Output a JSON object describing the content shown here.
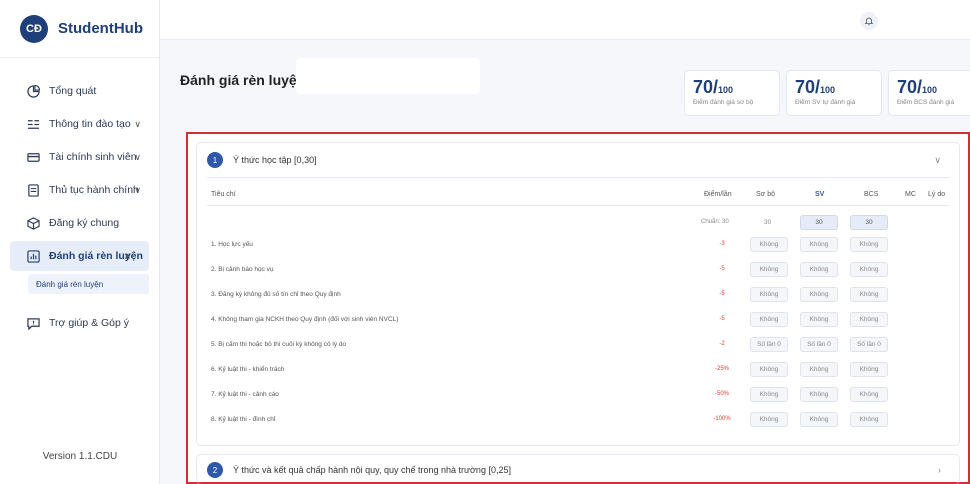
{
  "app": {
    "name": "StudentHub",
    "logo_text": "CĐ",
    "version": "Version 1.1.CDU"
  },
  "sidebar": {
    "items": [
      {
        "label": "Tổng quát",
        "icon": "pie-chart-icon",
        "has_chevron": false
      },
      {
        "label": "Thông tin đào tạo",
        "icon": "list-icon",
        "has_chevron": true
      },
      {
        "label": "Tài chính sinh viên",
        "icon": "card-icon",
        "has_chevron": true
      },
      {
        "label": "Thủ tục hành chính",
        "icon": "document-icon",
        "has_chevron": true
      },
      {
        "label": "Đăng ký chung",
        "icon": "box-icon",
        "has_chevron": false
      },
      {
        "label": "Đánh giá rèn luyện",
        "icon": "bar-chart-icon",
        "has_chevron": true,
        "active": true
      },
      {
        "label": "Trợ giúp & Góp ý",
        "icon": "message-icon",
        "has_chevron": false
      }
    ],
    "sub_item": "Đánh giá rèn luyện"
  },
  "header": {
    "notification_icon": "bell-icon"
  },
  "page": {
    "title": "Đánh giá rèn luyện",
    "scores": [
      {
        "value": "70/",
        "denominator": "100",
        "label": "Điểm đánh giá sơ bộ"
      },
      {
        "value": "70/",
        "denominator": "100",
        "label": "Điểm SV tự đánh giá"
      },
      {
        "value": "70/",
        "denominator": "100",
        "label": "Điểm BCS đánh giá"
      }
    ]
  },
  "sections": [
    {
      "number": "1",
      "title": "Ý thức học tập [0,30]",
      "expanded": true
    },
    {
      "number": "2",
      "title": "Ý thức và kết quả chấp hành nội quy, quy chế trong nhà trường [0,25]",
      "expanded": false
    }
  ],
  "table": {
    "headers": {
      "criteria": "Tiêu chí",
      "points": "Điểm/lần",
      "preliminary": "Sơ bộ",
      "sv": "SV",
      "bcs": "BCS",
      "mc": "MC",
      "reason": "Lý do"
    },
    "standard_row": {
      "label": "Chuẩn: 30",
      "preliminary": "30",
      "sv": "30",
      "bcs": "30"
    },
    "rows": [
      {
        "criteria": "1. Học lực yếu",
        "points": "-3",
        "preliminary": "Không",
        "sv": "Không",
        "bcs": "Không"
      },
      {
        "criteria": "2. Bị cảnh báo học vụ",
        "points": "-5",
        "preliminary": "Không",
        "sv": "Không",
        "bcs": "Không"
      },
      {
        "criteria": "3. Đăng ký không đủ số tín chỉ theo Quy định",
        "points": "-5",
        "preliminary": "Không",
        "sv": "Không",
        "bcs": "Không"
      },
      {
        "criteria": "4. Không tham gia NCKH theo Quy định (đối với sinh viên NVCL)",
        "points": "-5",
        "preliminary": "Không",
        "sv": "Không",
        "bcs": "Không"
      },
      {
        "criteria": "5. Bị cấm thi hoặc bỏ thi cuối kỳ không có lý do",
        "points": "-2",
        "preliminary": "Số lần 0",
        "sv": "Số lần 0",
        "bcs": "Số lần 0"
      },
      {
        "criteria": "6. Kỷ luật thi - khiển trách",
        "points": "-25%",
        "preliminary": "Không",
        "sv": "Không",
        "bcs": "Không"
      },
      {
        "criteria": "7. Kỷ luật thi - cảnh cáo",
        "points": "-50%",
        "preliminary": "Không",
        "sv": "Không",
        "bcs": "Không"
      },
      {
        "criteria": "8. Kỷ luật thi - đình chỉ",
        "points": "-100%",
        "preliminary": "Không",
        "sv": "Không",
        "bcs": "Không"
      }
    ]
  },
  "colors": {
    "primary": "#1f3f7a",
    "accent": "#2f59a8",
    "penalty": "#e53935",
    "highlight_border": "#d32f2f"
  }
}
